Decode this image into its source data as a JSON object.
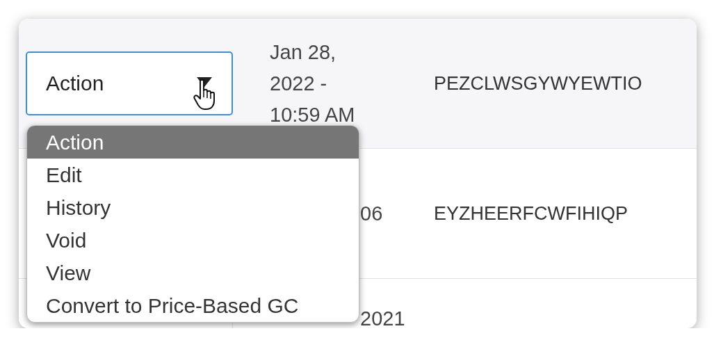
{
  "table": {
    "rows": [
      {
        "highlighted": true,
        "action": "Action",
        "date": "Jan 28, 2022 - 10:59 AM",
        "code": "PEZCLWSGYWYEWTIO"
      },
      {
        "date": "06",
        "code": "EYZHEERFCWFIHIQP"
      },
      {
        "date": "2021"
      }
    ]
  },
  "action_menu": {
    "open": true,
    "options": [
      {
        "label": "Action",
        "selected": true
      },
      {
        "label": "Edit",
        "selected": false
      },
      {
        "label": "History",
        "selected": false
      },
      {
        "label": "Void",
        "selected": false
      },
      {
        "label": "View",
        "selected": false
      },
      {
        "label": "Convert to Price-Based GC",
        "selected": false
      }
    ]
  }
}
